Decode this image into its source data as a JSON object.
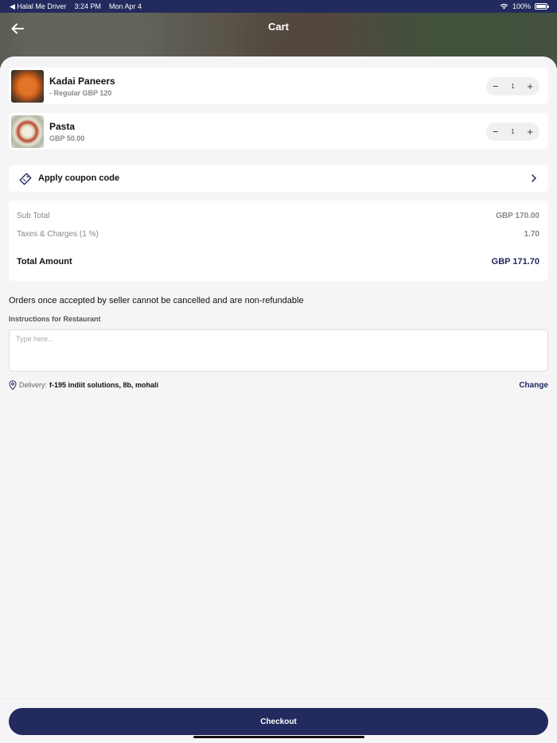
{
  "status_bar": {
    "back_app": "◀ Halal Me Driver",
    "time": "3:24 PM",
    "date": "Mon Apr 4",
    "battery": "100%"
  },
  "header": {
    "title": "Cart"
  },
  "cart_items": [
    {
      "name": "Kadai Paneers",
      "sub": "- Regular GBP 120",
      "qty": "1"
    },
    {
      "name": "Pasta",
      "sub": "GBP 50.00",
      "qty": "1"
    }
  ],
  "coupon": {
    "label": "Apply coupon code"
  },
  "summary": {
    "subtotal_label": "Sub Total",
    "subtotal_value": "GBP 170.00",
    "taxes_label": "Taxes & Charges (1 %)",
    "taxes_value": "1.70",
    "total_label": "Total Amount",
    "total_value": "GBP 171.70"
  },
  "notice": "Orders once accepted by seller cannot be cancelled and are non-refundable",
  "instructions": {
    "label": "Instructions for Restaurant",
    "placeholder": "Type here..."
  },
  "delivery": {
    "label": "Delivery:",
    "address": "f-195 indiit solutions, 8b, mohali",
    "change_label": "Change"
  },
  "footer": {
    "checkout_label": "Checkout"
  },
  "colors": {
    "brand": "#222a5e"
  }
}
